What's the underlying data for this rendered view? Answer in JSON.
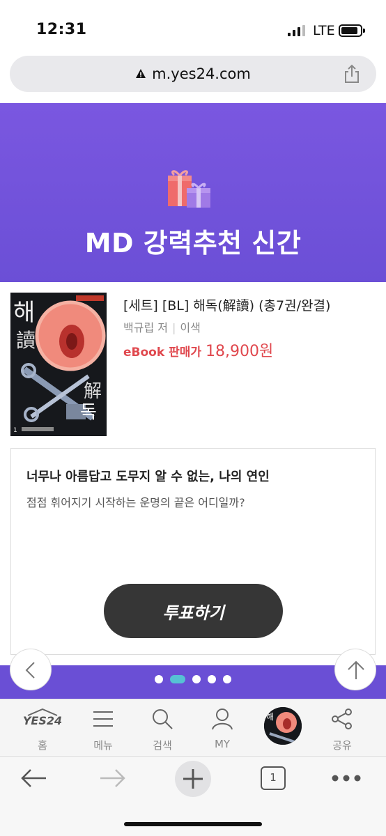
{
  "status_bar": {
    "time": "12:31",
    "network": "LTE"
  },
  "url_bar": {
    "domain": "m.yes24.com"
  },
  "banner": {
    "title": "MD 강력추천 신간"
  },
  "product": {
    "title": "[세트] [BL] 해독(解讀) (총7권/완결)",
    "author": "백규립 저",
    "publisher": "이색",
    "price_label": "eBook 판매가",
    "price": "18,900원"
  },
  "card": {
    "heading": "너무나 아름답고 도무지 알 수 없는, 나의 연인",
    "subtext": "점점 휘어지기 시작하는 운명의 끝은 어디일까?",
    "vote_label": "투표하기"
  },
  "carousel": {
    "dot_count": 5,
    "active_index": 1
  },
  "site_nav": {
    "logo": "YES24",
    "items": [
      {
        "label": "홈",
        "icon": "home-icon"
      },
      {
        "label": "메뉴",
        "icon": "menu-icon"
      },
      {
        "label": "검색",
        "icon": "search-icon"
      },
      {
        "label": "MY",
        "icon": "user-icon"
      },
      {
        "label": "",
        "icon": "recent-thumbnail"
      },
      {
        "label": "공유",
        "icon": "share-icon"
      }
    ]
  },
  "browser_toolbar": {
    "tab_count": "1"
  },
  "colors": {
    "banner": "#6b4fd6",
    "price": "#e0484e",
    "vote_button": "#363636",
    "active_dot": "#56c1d4"
  }
}
